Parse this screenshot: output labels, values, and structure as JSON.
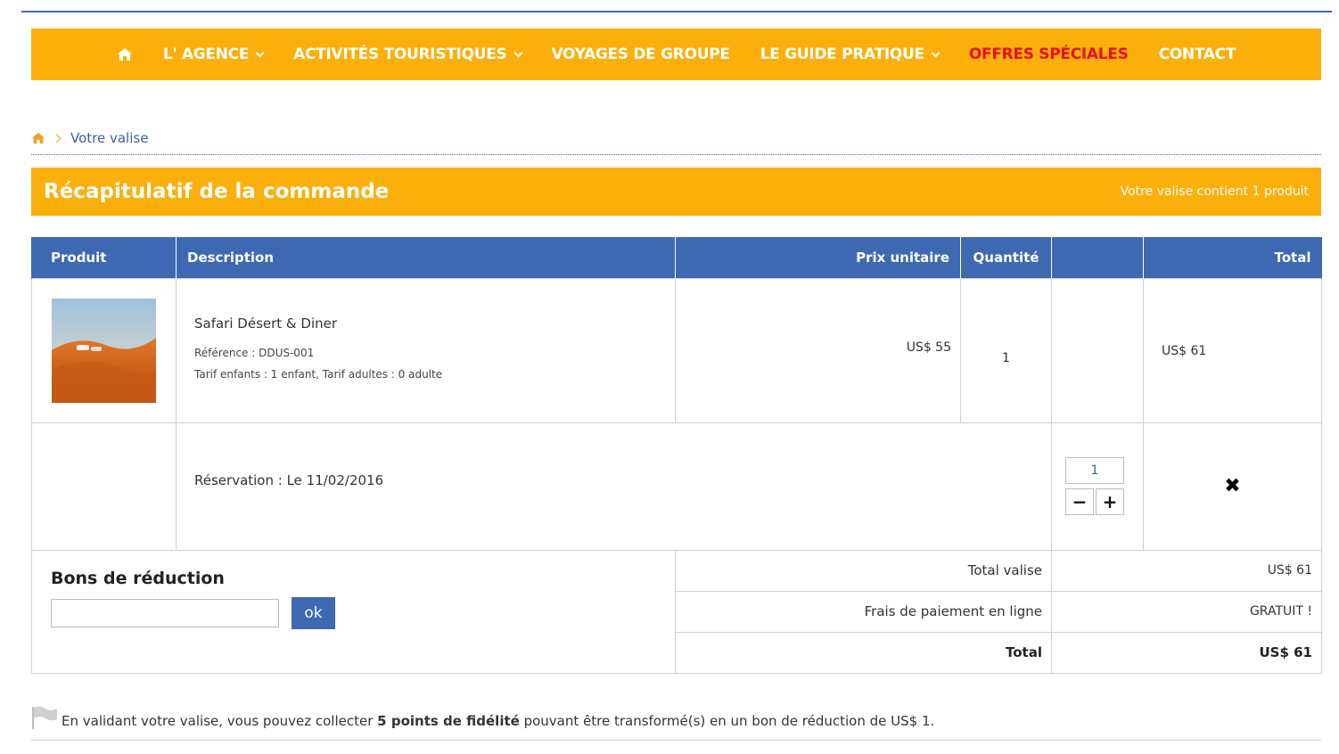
{
  "nav": {
    "items": [
      {
        "label": "L' AGENCE",
        "dropdown": true
      },
      {
        "label": "ACTIVITÉS TOURISTIQUES",
        "dropdown": true
      },
      {
        "label": "VOYAGES DE GROUPE",
        "dropdown": false
      },
      {
        "label": "LE GUIDE PRATIQUE",
        "dropdown": true
      },
      {
        "label": "OFFRES SPÉCIALES",
        "dropdown": false
      },
      {
        "label": "CONTACT",
        "dropdown": false
      }
    ]
  },
  "breadcrumb": {
    "current": "Votre valise"
  },
  "summary": {
    "title": "Récapitulatif de la commande",
    "count": "Votre valise contient 1 produit"
  },
  "table": {
    "headers": {
      "product": "Produit",
      "description": "Description",
      "unit_price": "Prix unitaire",
      "quantity": "Quantité",
      "blank": "",
      "total": "Total"
    },
    "item": {
      "name": "Safari Désert & Diner",
      "reference": "Référence : DDUS-001",
      "tariffs": "Tarif enfants : 1 enfant, Tarif adultes : 0 adulte",
      "unit_price": "US$ 55",
      "quantity": "1",
      "total": "US$ 61"
    },
    "reservation": {
      "text": "Réservation : Le 11/02/2016",
      "qty_value": "1",
      "minus": "−",
      "plus": "+",
      "remove": "✖"
    }
  },
  "coupon": {
    "title": "Bons de réduction",
    "button": "ok",
    "value": ""
  },
  "totals": {
    "subtotal_label": "Total valise",
    "subtotal_value": "US$ 61",
    "fees_label": "Frais de paiement en ligne",
    "fees_value": "GRATUIT !",
    "total_label": "Total",
    "total_value": "US$ 61"
  },
  "loyalty": {
    "prefix": "En validant votre valise, vous pouvez collecter",
    "points": "5 points de fidélité",
    "suffix": "pouvant être transformé(s) en un bon de réduction de US$ 1."
  },
  "colors": {
    "accent": "#fbaf0b",
    "primary": "#3e69b2",
    "special": "#e8101a"
  },
  "icons": [
    "home-icon",
    "chevron-down-icon",
    "chevron-right-icon",
    "remove-icon",
    "flag-icon"
  ]
}
